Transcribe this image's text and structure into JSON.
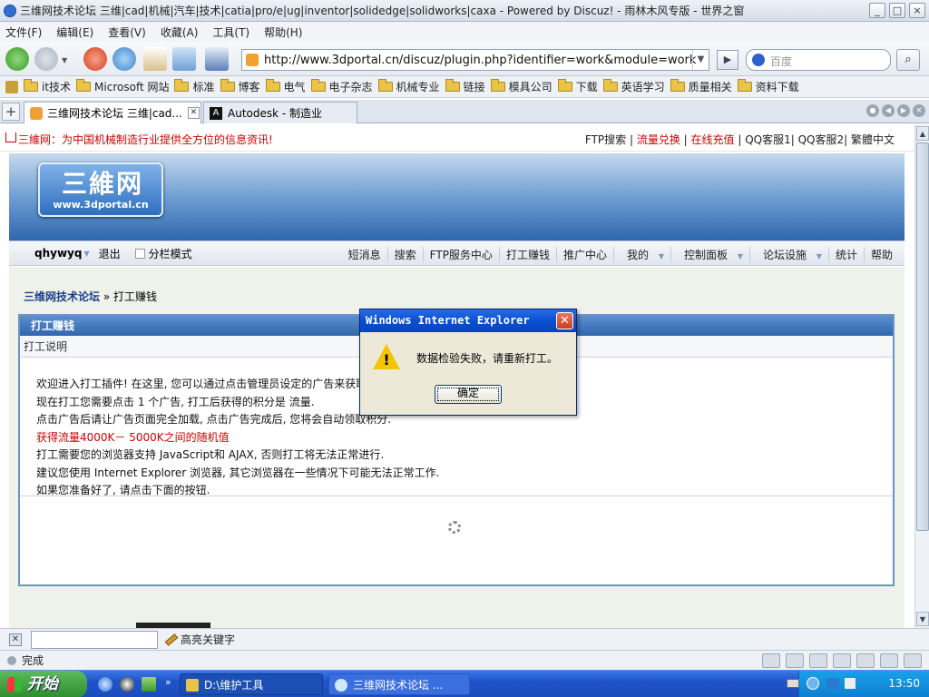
{
  "window": {
    "title": "三维网技术论坛 三维|cad|机械|汽车|技术|catia|pro/e|ug|inventor|solidedge|solidworks|caxa - Powered by Discuz! - 雨林木风专版 - 世界之窗",
    "controls": [
      "_",
      "□",
      "×"
    ]
  },
  "menu": [
    "文件(F)",
    "编辑(E)",
    "查看(V)",
    "收藏(A)",
    "工具(T)",
    "帮助(H)"
  ],
  "address": {
    "url": "http://www.3dportal.cn/discuz/plugin.php?identifier=work&module=work",
    "search_placeholder": "百度"
  },
  "favorites": [
    "it技术",
    "Microsoft 网站",
    "标准",
    "博客",
    "电气",
    "电子杂志",
    "机械专业",
    "链接",
    "模具公司",
    "下载",
    "英语学习",
    "质量相关",
    "资料下载"
  ],
  "tabs": [
    {
      "label": "三维网技术论坛 三维|cad...",
      "active": true
    },
    {
      "label": "Autodesk - 制造业",
      "active": false
    }
  ],
  "site": {
    "slogan": "三維网：为中国机械制造行业提供全方位的信息资讯!",
    "top_links": [
      "FTP搜索",
      "流量兑换",
      "在线充值",
      "QQ客服1",
      "QQ客服2",
      "繁體中文"
    ],
    "logo_main": "三維网",
    "logo_url": "www.3dportal.cn",
    "user": "qhywyq",
    "logout": "退出",
    "column_mode": "分栏模式",
    "nav": [
      "短消息",
      "搜索",
      "FTP服务中心",
      "打工赚钱",
      "推广中心",
      "我的",
      "控制面板",
      "论坛设施",
      "统计",
      "帮助"
    ],
    "breadcrumb_home": "三维网技术论坛",
    "breadcrumb_current": "» 打工赚钱",
    "box_title": "打工赚钱",
    "box_subtitle": "打工说明",
    "desc_lines": [
      "欢迎进入打工插件! 在这里, 您可以通过点击管理员设定的广告来获取",
      "现在打工您需要点击  1 个广告, 打工后获得的积分是  流量.",
      "点击广告后请让广告页面完全加载, 点击广告完成后, 您将会自动领取积分.",
      "获得流量4000K－ 5000K之间的随机值",
      "打工需要您的浏览器支持  JavaScript和  AJAX, 否则打工将无法正常进行.",
      "建议您使用  Internet Explorer 浏览器, 其它浏览器在一些情况下可能无法正常工作.",
      "如果您准备好了, 请点击下面的按钮."
    ]
  },
  "findbar": {
    "highlight_label": "高亮关键字"
  },
  "status": {
    "text": "完成"
  },
  "taskbar": {
    "start": "开始",
    "items": [
      "D:\\维护工具",
      "三维网技术论坛 ..."
    ],
    "clock": "13:50"
  },
  "dialog": {
    "title": "Windows Internet Explorer",
    "message": "数据检验失败，请重新打工。",
    "ok": "确定"
  }
}
